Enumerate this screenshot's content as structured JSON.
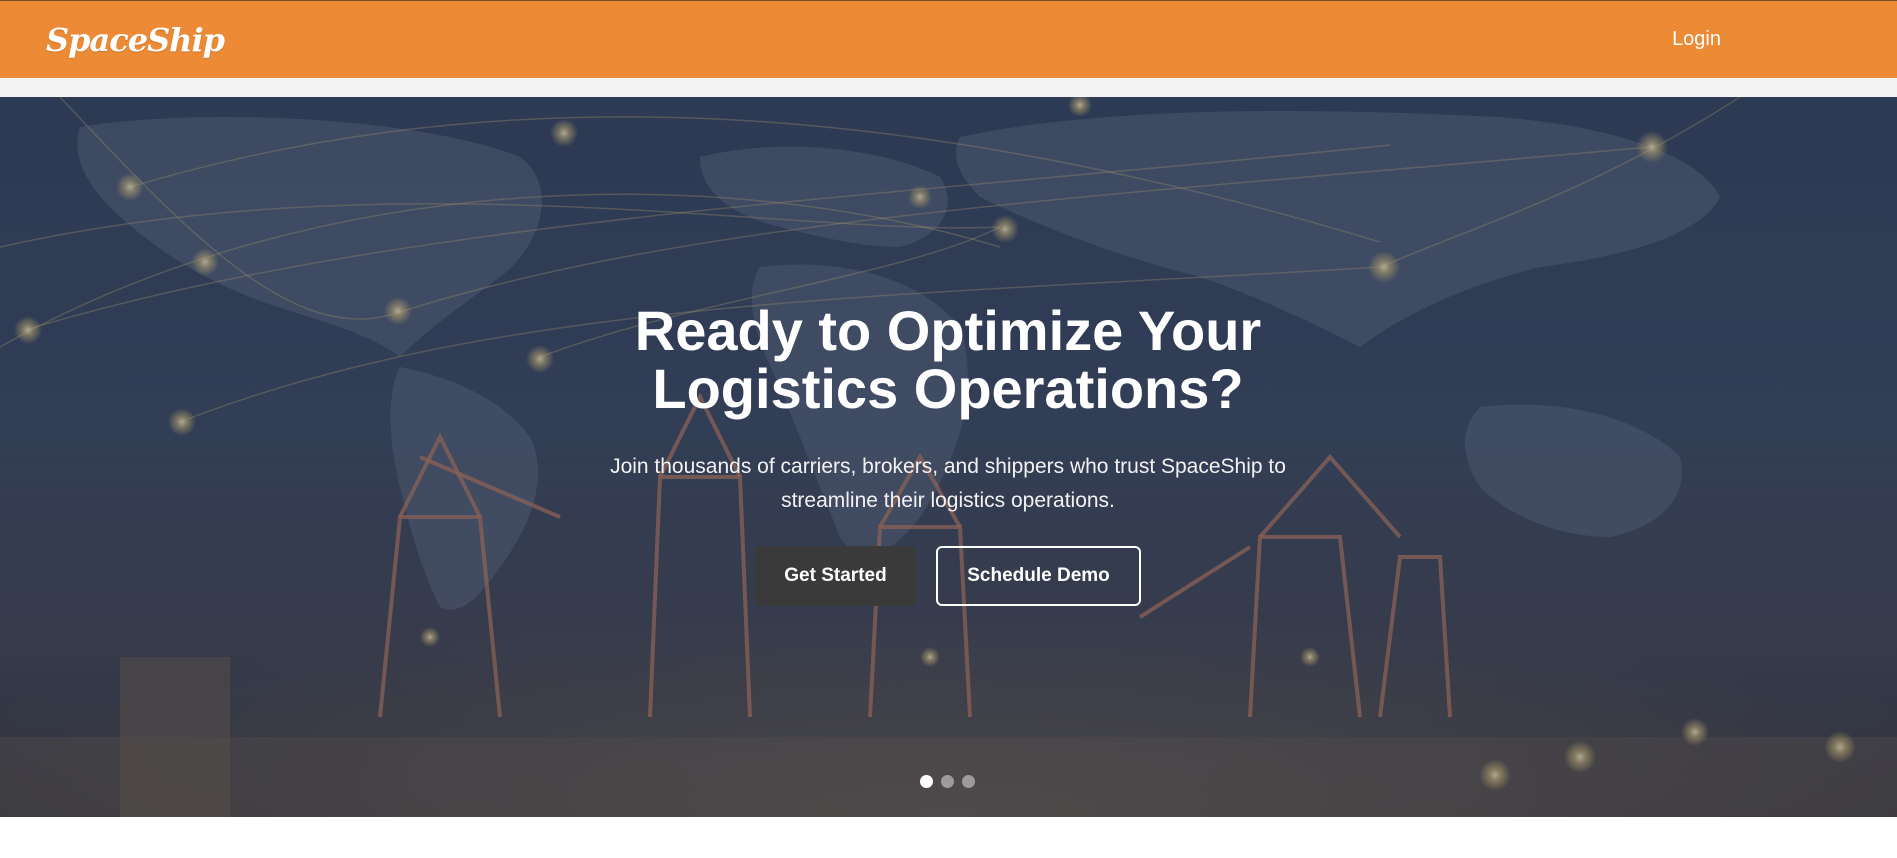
{
  "brand": {
    "name": "SpaceShip",
    "accent_color": "#ec8a35"
  },
  "nav": {
    "login_label": "Login"
  },
  "hero": {
    "title_line1": "Ready to Optimize Your",
    "title_line2": "Logistics Operations?",
    "subtitle_line1": "Join thousands of carriers, brokers, and shippers who trust SpaceShip to",
    "subtitle_line2": "streamline their logistics operations.",
    "primary_button": "Get Started",
    "secondary_button": "Schedule Demo",
    "background_image": "world-map-network-over-port-cranes",
    "carousel": {
      "slide_count": 3,
      "active_index": 0
    }
  }
}
